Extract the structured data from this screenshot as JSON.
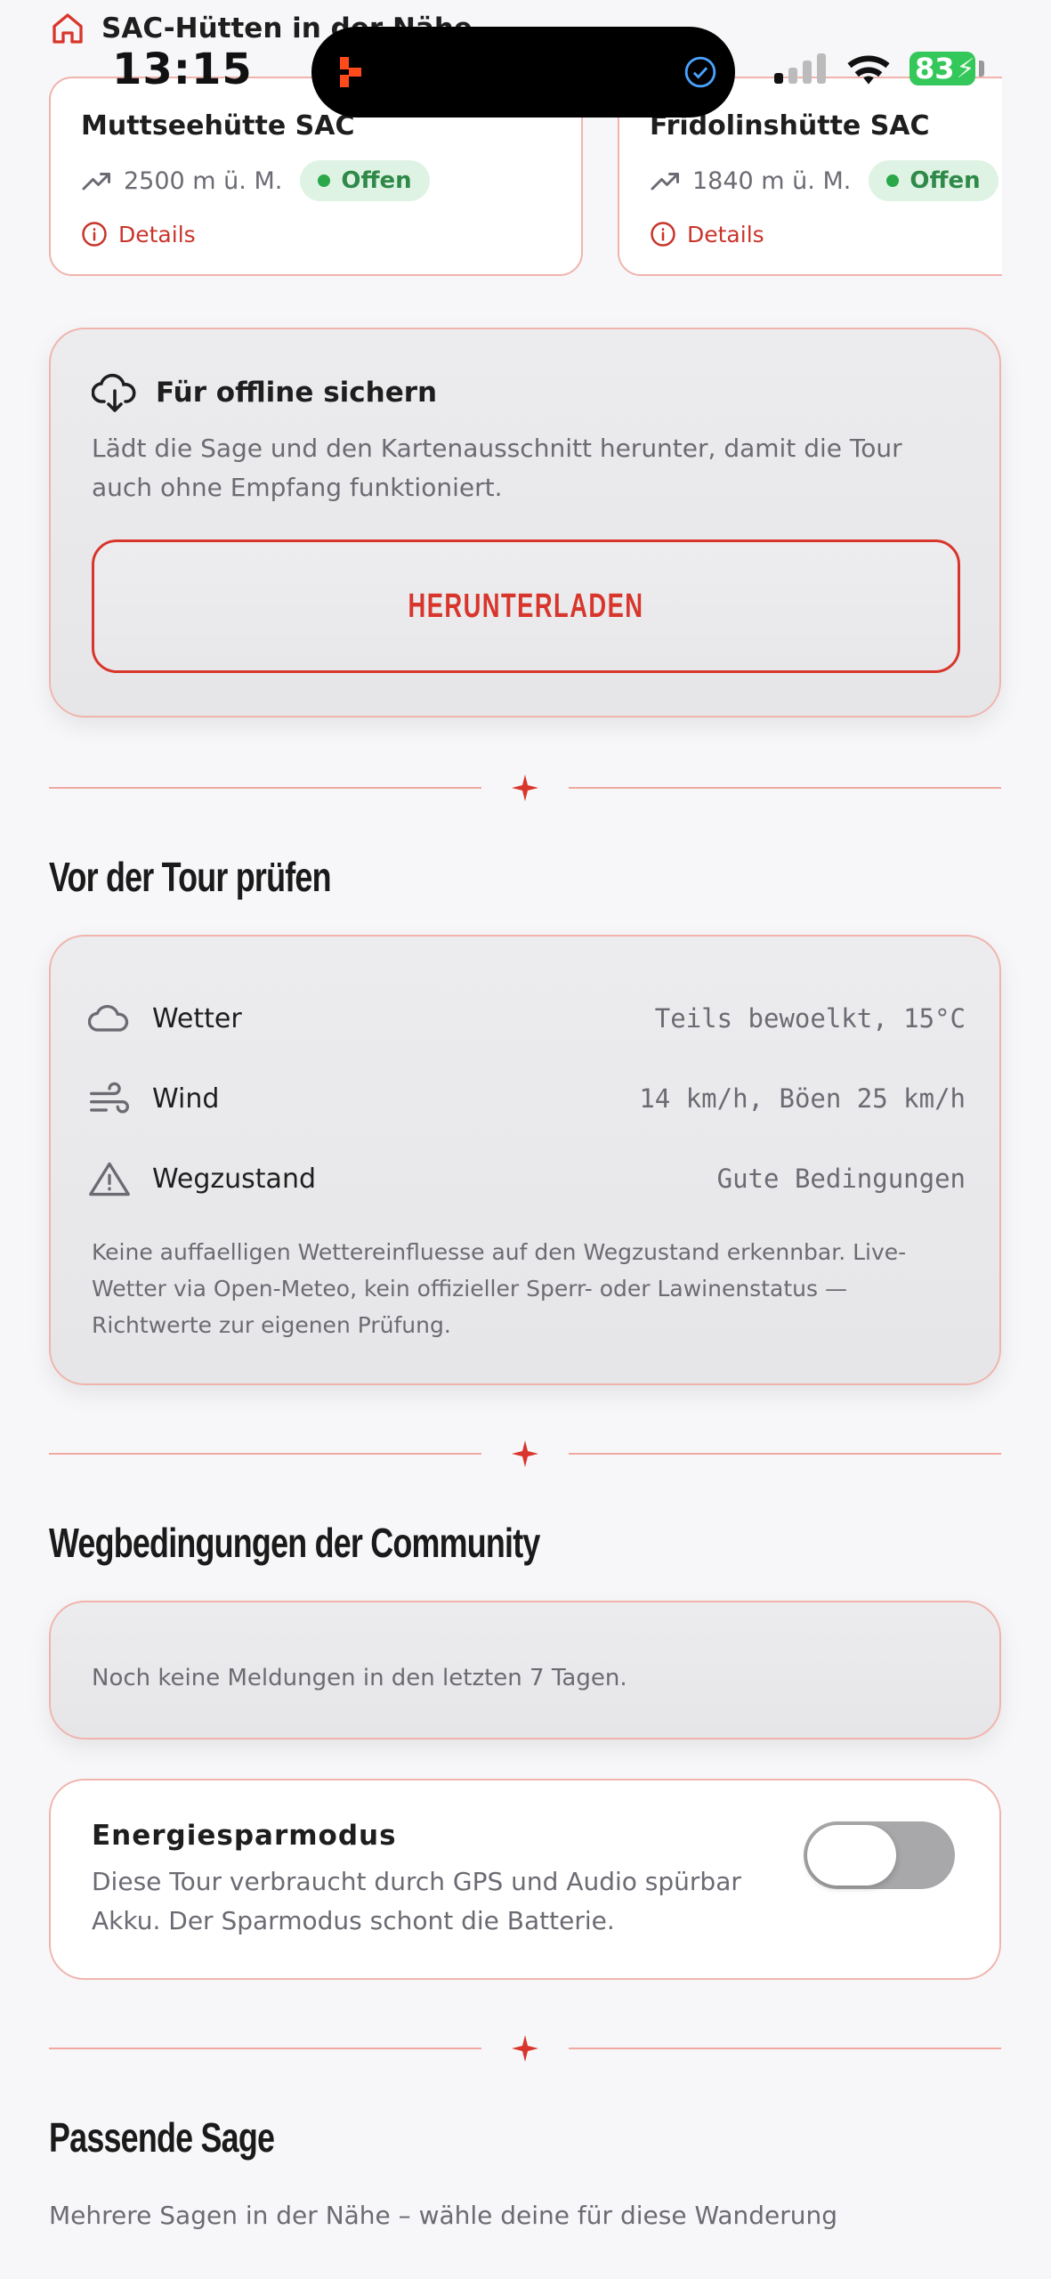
{
  "status_bar": {
    "time": "13:15",
    "battery": "83"
  },
  "huts": {
    "heading": "SAC-Hütten in der Nähe",
    "items": [
      {
        "name": "Muttseehütte SAC",
        "altitude": "2500 m ü. M.",
        "status": "Offen",
        "details": "Details"
      },
      {
        "name": "Fridolinshütte SAC",
        "altitude": "1840 m ü. M.",
        "status": "Offen",
        "details": "Details"
      }
    ]
  },
  "offline": {
    "title": "Für offline sichern",
    "description": "Lädt die Sage und den Kartenausschnitt herunter, damit die Tour auch ohne Empfang funktioniert.",
    "button": "HERUNTERLADEN"
  },
  "checks": {
    "title": "Vor der Tour prüfen",
    "rows": [
      {
        "icon": "cloud-icon",
        "label": "Wetter",
        "value": "Teils bewoelkt, 15°C"
      },
      {
        "icon": "wind-icon",
        "label": "Wind",
        "value": "14 km/h, Böen 25 km/h"
      },
      {
        "icon": "warning-icon",
        "label": "Wegzustand",
        "value": "Gute Bedingungen"
      }
    ],
    "note": "Keine auffaelligen Wettereinfluesse auf den Wegzustand erkennbar. Live-Wetter via Open-Meteo, kein offizieller Sperr- oder Lawinenstatus — Richtwerte zur eigenen Prüfung."
  },
  "community": {
    "title": "Wegbedingungen der Community",
    "empty": "Noch keine Meldungen in den letzten 7 Tagen."
  },
  "energy": {
    "title": "Energiesparmodus",
    "description": "Diese Tour verbraucht durch GPS und Audio spürbar Akku. Der Sparmodus schont die Batterie.",
    "enabled": false
  },
  "sage": {
    "title": "Passende Sage",
    "subtitle": "Mehrere Sagen in der Nähe – wähle deine für diese Wanderung"
  },
  "colors": {
    "accent": "#d8362c",
    "border": "#f0b4ad",
    "open": "#2aa84a"
  }
}
